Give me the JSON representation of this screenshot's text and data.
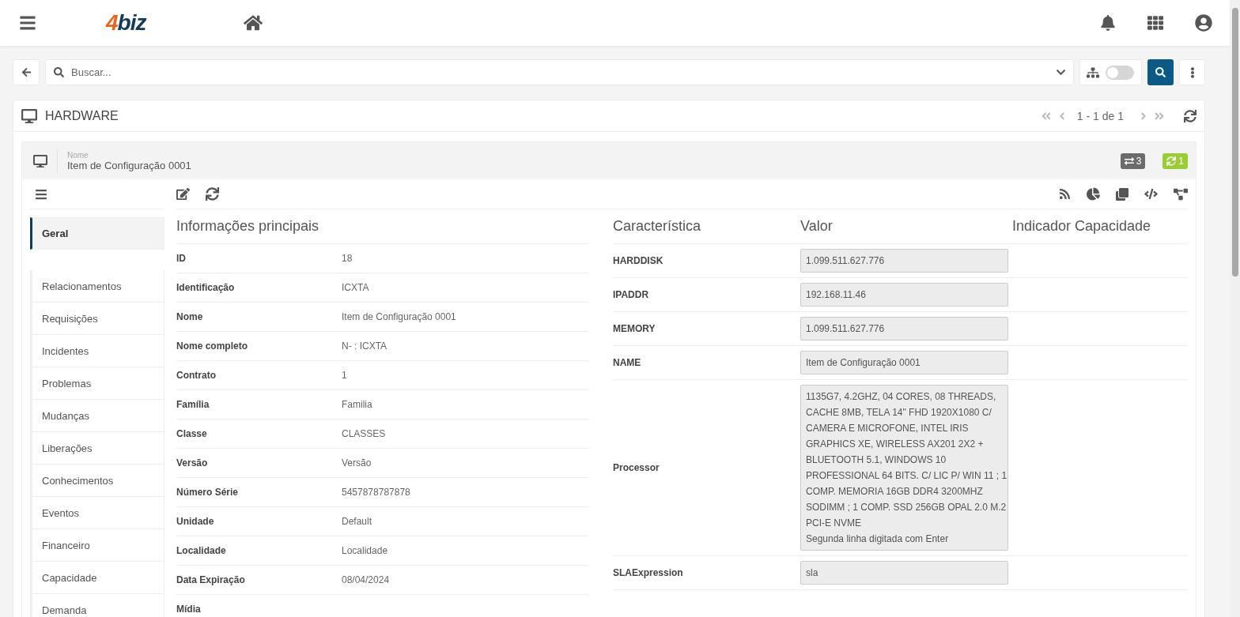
{
  "header": {
    "logo": {
      "digit": "4",
      "word": "biz"
    }
  },
  "search": {
    "placeholder": "Buscar...",
    "hierarchy_toggle": {
      "on": false
    }
  },
  "panel": {
    "title": "HARDWARE",
    "pagination": "1 - 1 de 1"
  },
  "item": {
    "name_label": "Nome",
    "name": "Item de Configuração 0001",
    "badges": [
      {
        "kind": "relations",
        "count": "3",
        "color": "#6b6b6b"
      },
      {
        "kind": "sync",
        "count": "1",
        "color": "#9acd32"
      }
    ]
  },
  "sidebar": {
    "items": [
      {
        "label": "Geral",
        "selected": true
      },
      {
        "label": "Relacionamentos",
        "selected": false
      },
      {
        "label": "Requisições",
        "selected": false
      },
      {
        "label": "Incidentes",
        "selected": false
      },
      {
        "label": "Problemas",
        "selected": false
      },
      {
        "label": "Mudanças",
        "selected": false
      },
      {
        "label": "Liberações",
        "selected": false
      },
      {
        "label": "Conhecimentos",
        "selected": false
      },
      {
        "label": "Eventos",
        "selected": false
      },
      {
        "label": "Financeiro",
        "selected": false
      },
      {
        "label": "Capacidade",
        "selected": false
      },
      {
        "label": "Demanda",
        "selected": false
      }
    ]
  },
  "main_info": {
    "title": "Informações principais",
    "rows": [
      {
        "label": "ID",
        "value": "18"
      },
      {
        "label": "Identificação",
        "value": "ICXTA"
      },
      {
        "label": "Nome",
        "value": "Item de Configuração 0001"
      },
      {
        "label": "Nome completo",
        "value": "N- : ICXTA"
      },
      {
        "label": "Contrato",
        "value": "1"
      },
      {
        "label": "Família",
        "value": "Familia"
      },
      {
        "label": "Classe",
        "value": "CLASSES"
      },
      {
        "label": "Versão",
        "value": "Versão"
      },
      {
        "label": "Número Série",
        "value": "5457878787878"
      },
      {
        "label": "Unidade",
        "value": "Default"
      },
      {
        "label": "Localidade",
        "value": "Localidade"
      },
      {
        "label": "Data Expiração",
        "value": "08/04/2024"
      },
      {
        "label": "Mídia",
        "value": ""
      }
    ]
  },
  "characteristics": {
    "columns": [
      "Característica",
      "Valor",
      "Indicador Capacidade"
    ],
    "rows": [
      {
        "name": "HARDDISK",
        "value_lines": [
          "1.099.511.627.776"
        ]
      },
      {
        "name": "IPADDR",
        "value_lines": [
          "192.168.11.46"
        ]
      },
      {
        "name": "MEMORY",
        "value_lines": [
          "1.099.511.627.776"
        ]
      },
      {
        "name": "NAME",
        "value_lines": [
          "Item de Configuração 0001"
        ]
      },
      {
        "name": "Processor",
        "value_lines": [
          "1135G7, 4.2GHZ, 04 CORES, 08 THREADS,",
          "CACHE 8MB, TELA 14\" FHD 1920X1080 C/",
          "CAMERA E MICROFONE, INTEL IRIS",
          "GRAPHICS XE, WIRELESS AX201 2X2 +",
          "BLUETOOTH 5.1, WINDOWS 10",
          "PROFESSIONAL 64 BITS. C/ LIC P/ WIN 11 ; 1",
          "COMP. MEMORIA 16GB DDR4 3200MHZ",
          "SODIMM ; 1 COMP. SSD 256GB OPAL 2.0 M.2",
          "PCI-E NVME",
          "Segunda linha digitada com Enter"
        ]
      },
      {
        "name": "SLAExpression",
        "value_lines": [
          "sla"
        ]
      }
    ]
  }
}
